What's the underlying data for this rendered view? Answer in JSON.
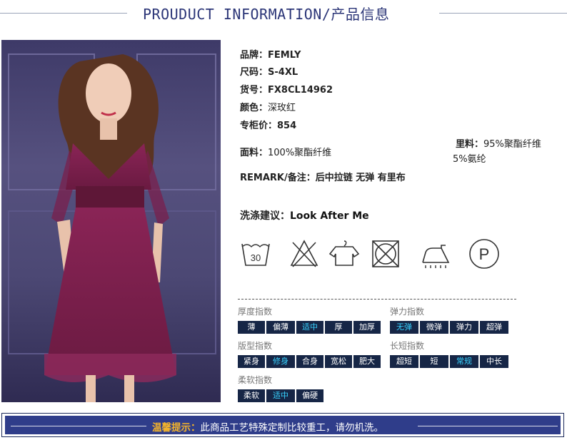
{
  "header": {
    "title": "PROUDUCT INFORMATION/产品信息"
  },
  "product": {
    "brand_label": "品牌：",
    "brand": "FEMLY",
    "size_label": "尺码：",
    "size": "S-4XL",
    "sku_label": "货号：",
    "sku": "FX8CL14962",
    "color_label": "颜色：",
    "color": "深玫红",
    "price_label": "专柜价：",
    "price": "854",
    "fabric_label": "面料：",
    "fabric": "100%聚酯纤维",
    "lining_label": "里料：",
    "lining_1": "95%聚酯纤维",
    "lining_2": "5%氨纶",
    "remark_label": "REMARK/备注：",
    "remark": "后中拉链 无弹 有里布"
  },
  "care": {
    "label": "洗涤建议：",
    "value": "Look After Me",
    "wash_temp": "30",
    "dryclean_letter": "P"
  },
  "indices": {
    "thickness": {
      "label": "厚度指数",
      "options": [
        "薄",
        "偏薄",
        "适中",
        "厚",
        "加厚"
      ],
      "selected": 2
    },
    "elasticity": {
      "label": "弹力指数",
      "options": [
        "无弹",
        "微弹",
        "弹力",
        "超弹"
      ],
      "selected": 0
    },
    "fit": {
      "label": "版型指数",
      "options": [
        "紧身",
        "修身",
        "合身",
        "宽松",
        "肥大"
      ],
      "selected": 1
    },
    "length": {
      "label": "长短指数",
      "options": [
        "超短",
        "短",
        "常规",
        "中长"
      ],
      "selected": 2
    },
    "softness": {
      "label": "柔软指数",
      "options": [
        "柔软",
        "适中",
        "偏硬"
      ],
      "selected": 1
    }
  },
  "tip": {
    "label": "温馨提示：",
    "text": "此商品工艺特殊定制比较重工，请勿机洗。"
  },
  "colors": {
    "accent": "#2b3577",
    "tag_bg": "#162646",
    "tag_active": "#38d2ff",
    "tip_bg": "#2f3d8a",
    "tip_highlight": "#f5b52b",
    "dress": "#7a1f4c"
  }
}
